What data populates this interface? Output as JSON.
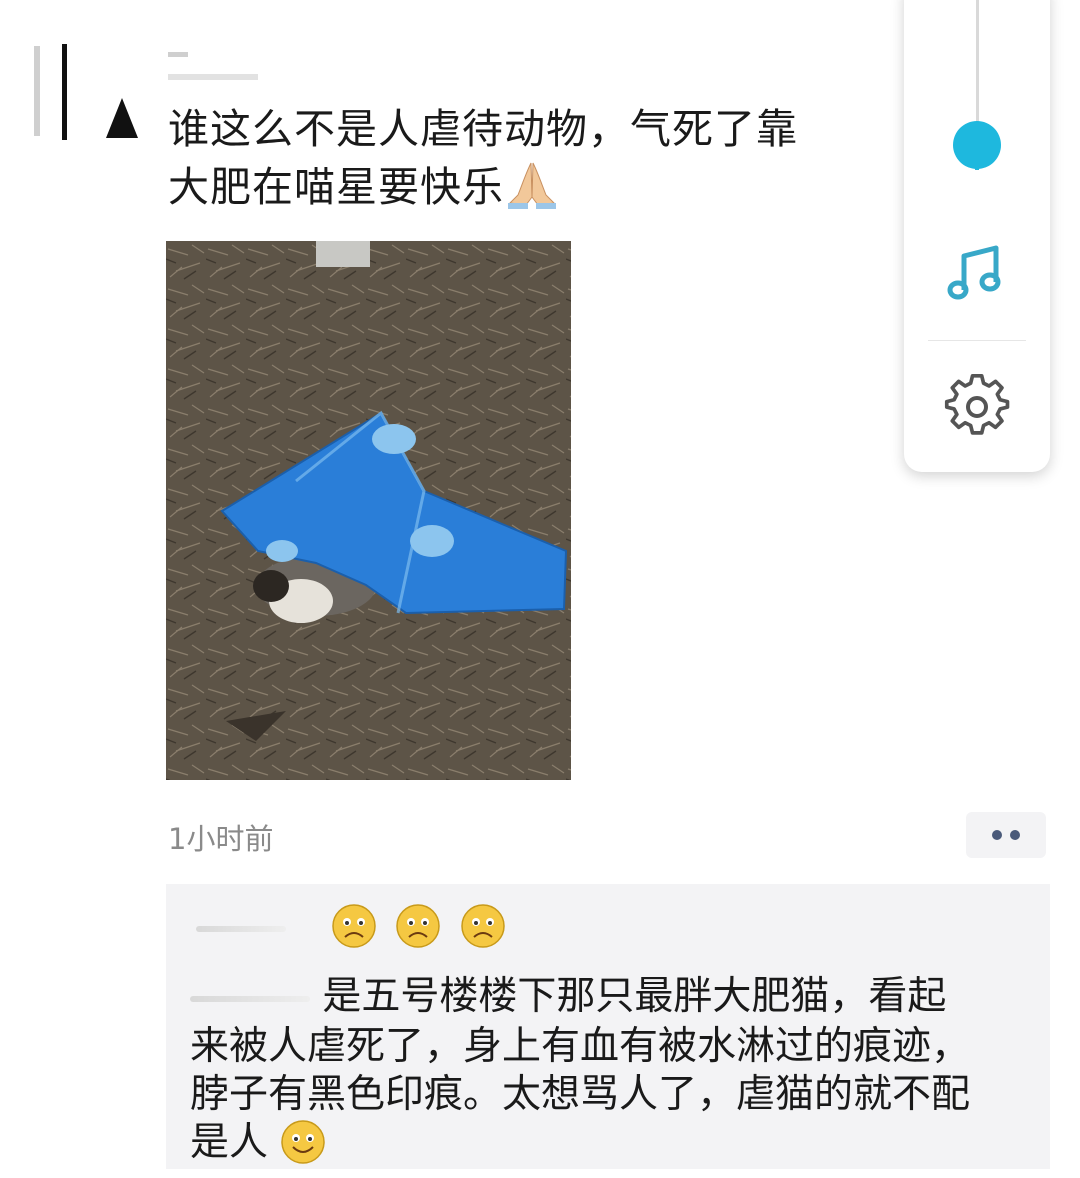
{
  "post": {
    "text_line1": "谁这么不是人虐待动物，气死了靠",
    "text_line2": "大肥在喵星要快乐",
    "timestamp": "1小时前"
  },
  "comments": {
    "reply_line1": "是五号楼楼下那只最胖大肥猫，看起",
    "reply_line2": "来被人虐死了，身上有血有被水淋过的痕迹，",
    "reply_line3": "脖子有黑色印痕。太想骂人了，虐猫的就不配",
    "reply_line4": "是人"
  },
  "icons": {
    "pray": "folded-hands-icon",
    "sad": "sad-face-icon",
    "smile": "smile-face-icon",
    "music": "music-note-icon",
    "settings": "gear-icon"
  },
  "colors": {
    "accent": "#1eb8de",
    "music": "#38a8c8",
    "comment_bg": "#f3f3f5"
  }
}
